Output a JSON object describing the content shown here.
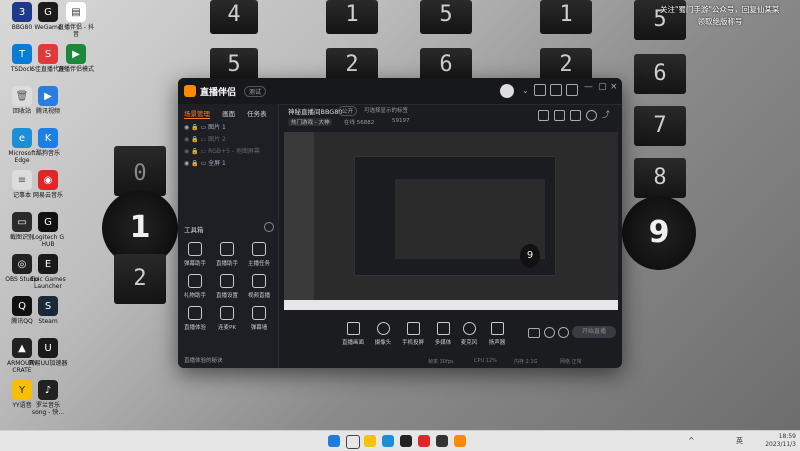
{
  "desktop": {
    "icons": [
      {
        "label": "BBG80",
        "color": "#1f3a8a",
        "glyph": "3"
      },
      {
        "label": "WeGame",
        "color": "#1c1c1c",
        "glyph": "G"
      },
      {
        "label": "直播伴侣 - 抖音",
        "color": "#ffffff",
        "glyph": "▤"
      },
      {
        "label": "TSDock",
        "color": "#0a7bd6",
        "glyph": "T"
      },
      {
        "label": "S佳直播代理",
        "color": "#e03b3b",
        "glyph": "S"
      },
      {
        "label": "直播伴侣模式",
        "color": "#1a8a3a",
        "glyph": "▶"
      },
      {
        "label": "回收站",
        "color": "#dcdcdc",
        "glyph": "🗑"
      },
      {
        "label": "腾讯视频",
        "color": "#2a7ce0",
        "glyph": "▶"
      },
      {
        "label": "Microsoft Edge",
        "color": "#1b8fd6",
        "glyph": "e"
      },
      {
        "label": "酷狗音乐",
        "color": "#1d7fe5",
        "glyph": "K"
      },
      {
        "label": "记事本",
        "color": "#dcdcdc",
        "glyph": "≡"
      },
      {
        "label": "网易云音乐",
        "color": "#e0262b",
        "glyph": "◉"
      },
      {
        "label": "截图识别",
        "color": "#2b2b2b",
        "glyph": "▭"
      },
      {
        "label": "Logitech G HUB",
        "color": "#111111",
        "glyph": "G"
      },
      {
        "label": "OBS Studio",
        "color": "#222222",
        "glyph": "◎"
      },
      {
        "label": "Epic Games Launcher",
        "color": "#1a1a1a",
        "glyph": "E"
      },
      {
        "label": "腾讯QQ",
        "color": "#111111",
        "glyph": "🐧"
      },
      {
        "label": "Steam",
        "color": "#1b2838",
        "glyph": "S"
      },
      {
        "label": "ARMOURY CRATE",
        "color": "#222222",
        "glyph": "▲"
      },
      {
        "label": "网易UU加速器",
        "color": "#1a1a1a",
        "glyph": "U"
      },
      {
        "label": "YY语音",
        "color": "#f6c000",
        "glyph": "Y"
      },
      {
        "label": "罗兰音乐 song - 快...",
        "color": "#222222",
        "glyph": "♪"
      }
    ]
  },
  "overlay": {
    "line1": "关注\"蜀门手游\"公众号，回复仙某某",
    "line2": "领取绝版称号"
  },
  "clock_digits": {
    "col1": [
      "4",
      "5"
    ],
    "col2": [
      "1",
      "2"
    ],
    "col3": [
      "5",
      "6"
    ],
    "col4": [
      "1",
      "2"
    ],
    "col5": [
      "5",
      "6",
      "7",
      "8",
      "9"
    ],
    "left_small_top": "0",
    "left_big": "1",
    "left_small_bottom": "2",
    "right_big": "9"
  },
  "app": {
    "name": "直播伴侣",
    "version_badge": "测试",
    "left_tabs": [
      "场景管理",
      "画面",
      "任务表"
    ],
    "scenes": [
      "图片 1",
      "图片 2",
      "RGB+5 - 地图屏幕",
      "全屏 1"
    ],
    "tools_header": "工具箱",
    "tools": [
      {
        "label": "弹幕助手"
      },
      {
        "label": "直播助手"
      },
      {
        "label": "主播任务"
      },
      {
        "label": "礼物助手"
      },
      {
        "label": "直播设置"
      },
      {
        "label": "视频直播"
      },
      {
        "label": "直播体验"
      },
      {
        "label": "连麦PK"
      },
      {
        "label": "弹幕墙"
      }
    ],
    "left_footer": "直播体验的秘诀",
    "stream_info": {
      "title": "神秘直播间BBG80",
      "tag": "公开",
      "subtitle": "可选择显示的标签",
      "category": "热门游戏 - 大神",
      "stat1_label": "在线",
      "stat1_value": "56882",
      "stat2_value": "59197"
    },
    "bottom_tools": [
      "直播画面",
      "摄像头",
      "手机投屏",
      "多媒体",
      "麦克风",
      "扬声器"
    ],
    "start_button": "开始直播",
    "status_items": [
      "帧率 30fps",
      "CPU 12%",
      "内存 2.1G",
      "网络 正常"
    ]
  },
  "taskbar": {
    "time": "18:59",
    "date": "2023/11/3",
    "lang": "英"
  }
}
